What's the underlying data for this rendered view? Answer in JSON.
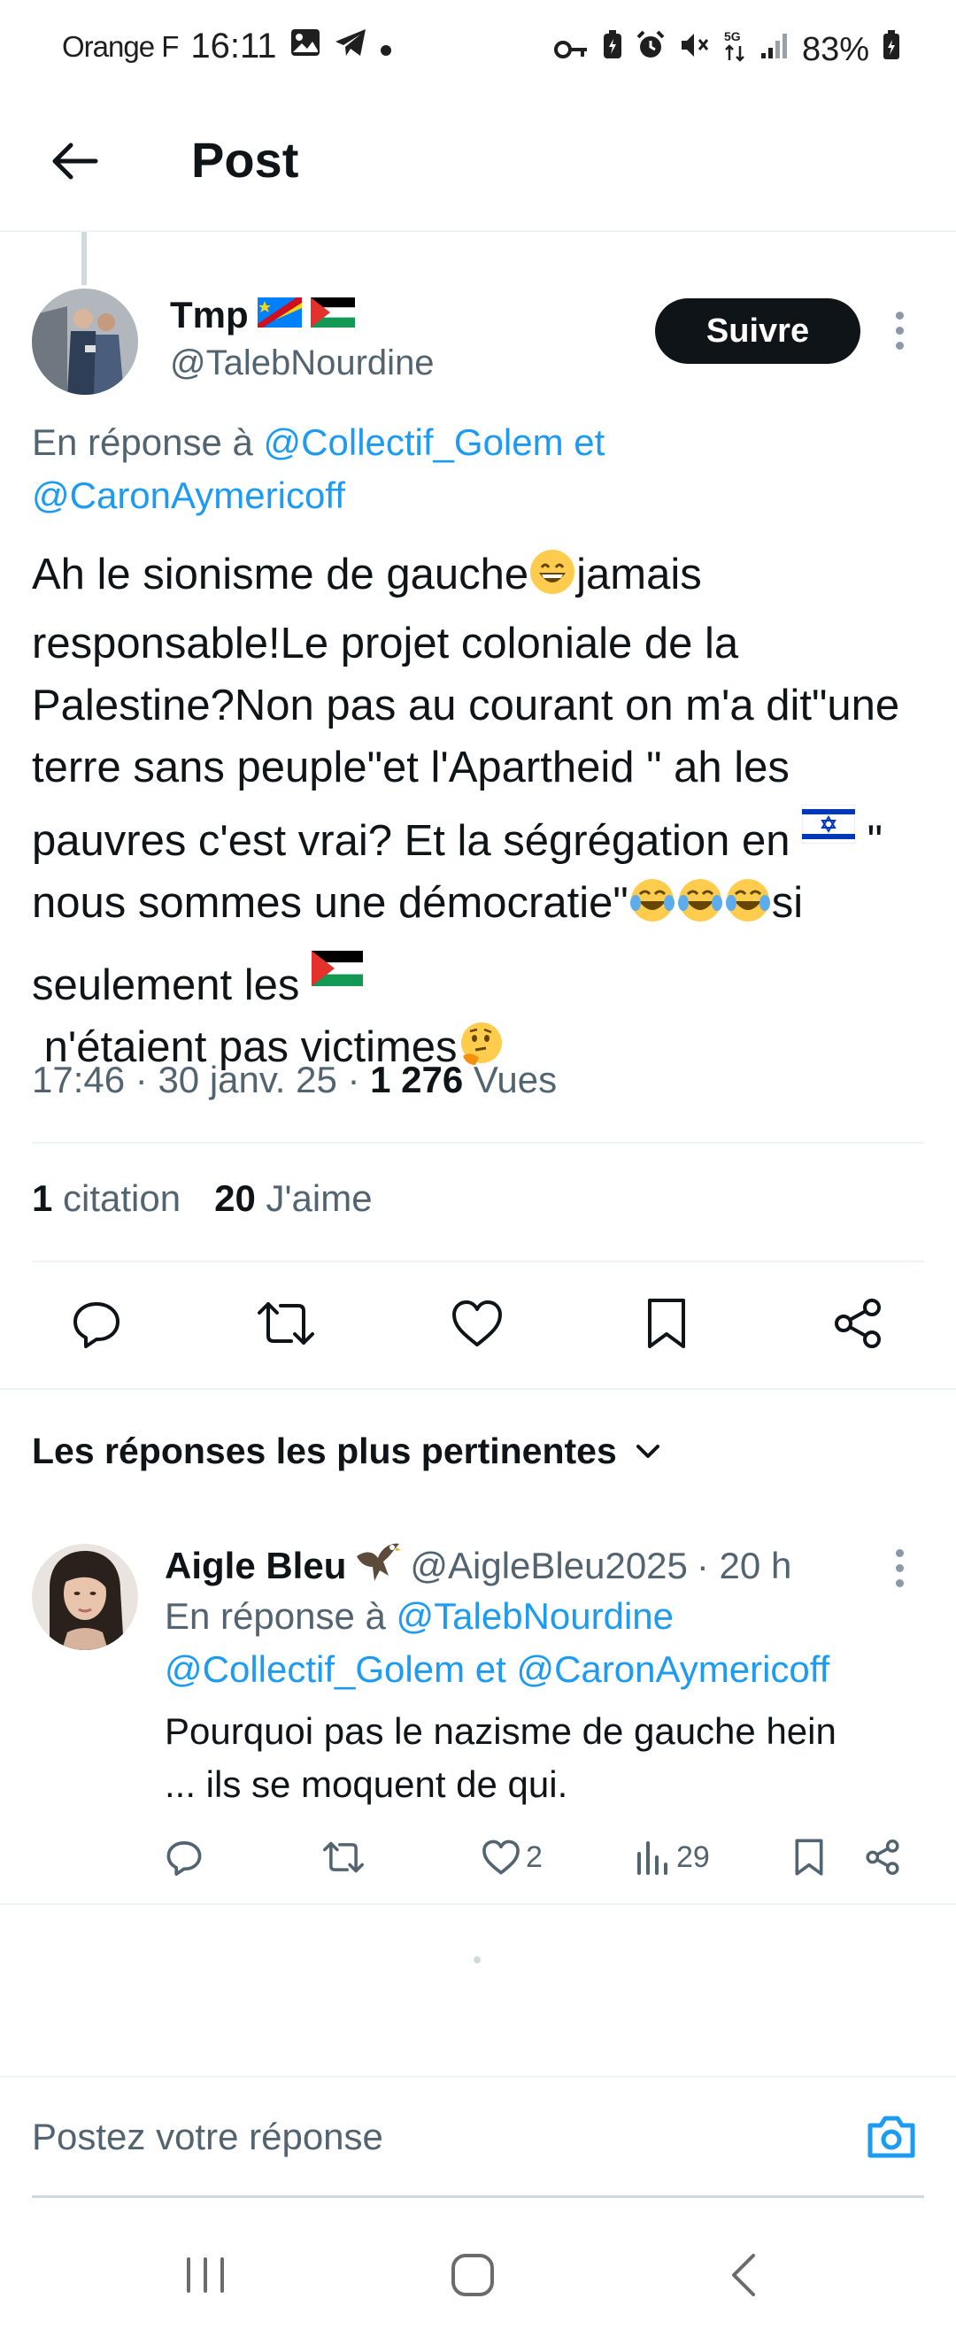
{
  "status_bar": {
    "carrier": "Orange F",
    "time": "16:11",
    "battery": "83%",
    "network": "5G"
  },
  "header": {
    "title": "Post"
  },
  "post": {
    "author_name": "Tmp",
    "author_handle": "@TalebNourdine",
    "follow_label": "Suivre",
    "reply_prefix": "En réponse à",
    "reply_mention_1": "@Collectif_Golem",
    "reply_joiner": "et",
    "reply_mention_2": "@CaronAymericoff",
    "text_parts": [
      "Ah le sionisme de gauche",
      "jamais responsable!Le projet coloniale de la Palestine?Non pas au courant on m'a dit\"une terre sans peuple\"et l'Apartheid \" ah les pauvres c'est vrai? Et la ségrégation en ",
      " \" nous sommes une démocratie\"",
      "si seulement les ",
      " n'étaient pas victimes"
    ],
    "time": "17:46",
    "date": "30 janv. 25",
    "views_count": "1 276",
    "views_label": "Vues",
    "quotes_count": "1",
    "quotes_label": "citation",
    "likes_count": "20",
    "likes_label": "J'aime"
  },
  "sort": {
    "label": "Les réponses les plus pertinentes"
  },
  "reply": {
    "name": "Aigle Bleu",
    "handle": "@AigleBleu2025",
    "time": "· 20 h",
    "reply_prefix": "En réponse à",
    "mention_1": "@TalebNourdine",
    "mention_2": "@Collectif_Golem",
    "joiner": "et",
    "mention_3": "@CaronAymericoff",
    "text": "Pourquoi pas le nazisme de gauche hein ... ils se moquent de qui.",
    "likes": "2",
    "views": "29"
  },
  "compose": {
    "placeholder": "Postez votre réponse"
  },
  "colors": {
    "accent": "#1d9bf0",
    "text": "#0f1419",
    "secondary": "#536471",
    "divider": "#eff3f4"
  },
  "icons": {
    "back": "arrow-left-icon",
    "reply": "reply-icon",
    "retweet": "retweet-icon",
    "like": "heart-icon",
    "bookmark": "bookmark-icon",
    "share": "share-icon",
    "views": "views-icon",
    "camera": "camera-icon",
    "chevron": "chevron-down-icon"
  }
}
